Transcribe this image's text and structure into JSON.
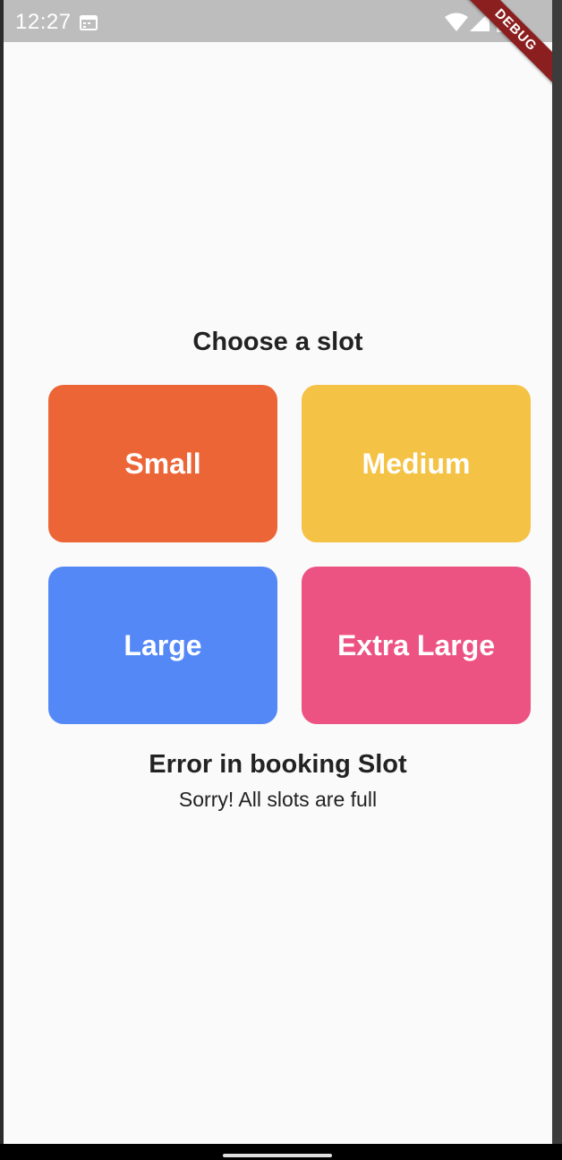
{
  "status_bar": {
    "time": "12:27",
    "icons": [
      "calendar-icon",
      "wifi-icon",
      "signal-icon",
      "battery-icon"
    ]
  },
  "debug_banner": "DEBUG",
  "title": "Choose a slot",
  "slots": [
    {
      "label": "Small",
      "color": "#ec6536"
    },
    {
      "label": "Medium",
      "color": "#f4c245"
    },
    {
      "label": "Large",
      "color": "#5488f7"
    },
    {
      "label": "Extra Large",
      "color": "#ec5382"
    }
  ],
  "error": {
    "title": "Error in booking Slot",
    "message": "Sorry! All slots are full"
  }
}
